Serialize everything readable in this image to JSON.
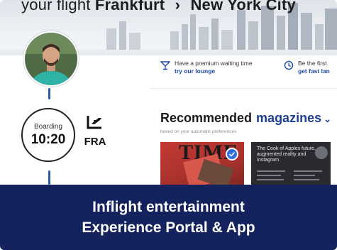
{
  "header": {
    "route_prefix": "your flight",
    "origin_city": "Frankfurt",
    "arrow": "›",
    "destination_city": "New York City"
  },
  "timeline": {
    "boarding_label": "Boarding",
    "boarding_time": "10:20",
    "airport_code": "FRA"
  },
  "tips": [
    {
      "text": "Have a premium waiting time",
      "link": "try our lounge",
      "icon": "cocktail-icon"
    },
    {
      "text": "Be the first",
      "link": "get fast lan",
      "icon": "clock-icon"
    }
  ],
  "magazines": {
    "title": "Recommended",
    "title_accent": "magazines",
    "subtitle": "based on your automatic preferences",
    "items": [
      {
        "masthead": "TIME",
        "selected": true
      },
      {
        "headline": "The Cook of Apples future, augmented reality and Instagram"
      }
    ]
  },
  "banner": {
    "line1": "Inflight entertainment",
    "line2": "Experience Portal & App"
  },
  "colors": {
    "banner_bg": "#14235e",
    "accent_blue": "#1f3f95",
    "timeline_blue": "#2b5aa8"
  }
}
